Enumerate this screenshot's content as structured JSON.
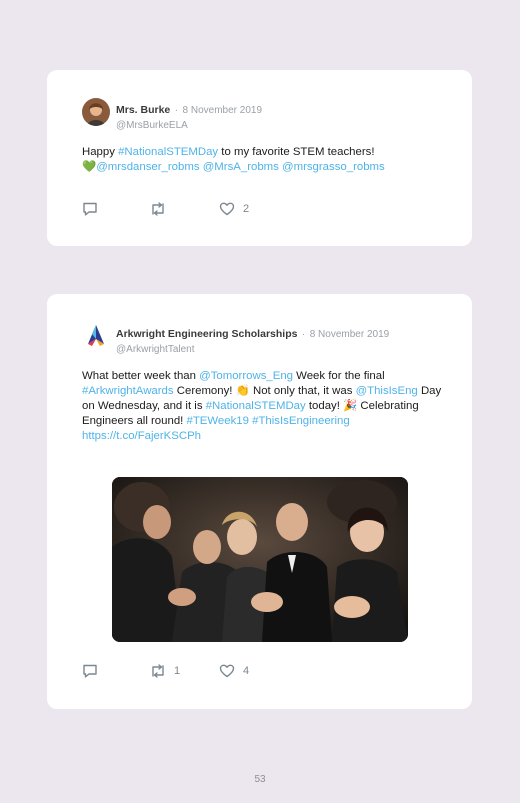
{
  "tweets": [
    {
      "name": "Mrs. Burke",
      "separator": "·",
      "date": "8 November 2019",
      "handle": "@MrsBurkeELA",
      "text": {
        "t1": "Happy ",
        "hashtag": "#NationalSTEMDay",
        "t2": " to my favorite STEM teachers!",
        "emoji": "💚",
        "m1": "@mrsdanser_robms",
        "sp1": " ",
        "m2": "@MrsA_robms",
        "sp2": " ",
        "m3": "@mrsgrasso_robms"
      },
      "likes": "2"
    },
    {
      "name": "Arkwright Engineering Scholarships",
      "separator": "·",
      "date": "8 November 2019",
      "handle": "@ArkwrightTalent",
      "text": {
        "t1": "What better week than ",
        "m1": "@Tomorrows_Eng",
        "t2": " Week for the final ",
        "h1": "#ArkwrightAwards",
        "t3": " Ceremony! ",
        "e1": "👏",
        "t4": " Not only that, it was ",
        "m2": "@ThisIsEng",
        "t5": " Day on Wednesday, and it is ",
        "h2": "#NationalSTEMDay",
        "t6": " today! ",
        "e2": "🎉",
        "t7": " Celebrating Engineers all round! ",
        "h3": "#TEWeek19",
        "sp": " ",
        "h4": "#ThisIsEngineering",
        "url": "https://t.co/FajerKSCPh"
      },
      "retweets": "1",
      "likes": "4"
    }
  ],
  "page_number": "53",
  "icons": [
    "reply-icon",
    "retweet-icon",
    "heart-icon"
  ],
  "colors": {
    "link": "#4fb3e8",
    "background": "#ece6ee"
  }
}
